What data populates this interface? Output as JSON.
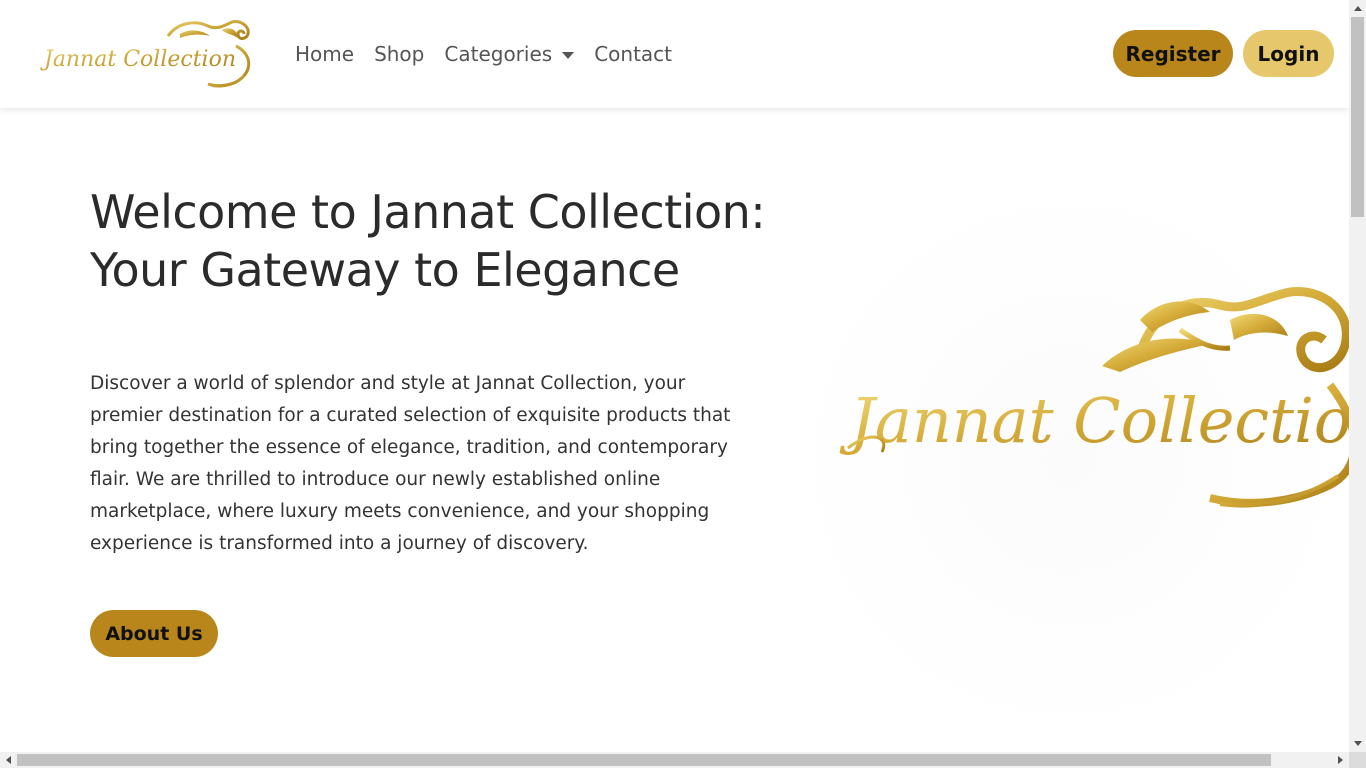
{
  "brand": {
    "logo_text": "Jannat Collection",
    "logo_color": "#c9a233"
  },
  "nav": {
    "links": [
      {
        "label": "Home"
      },
      {
        "label": "Shop"
      },
      {
        "label": "Categories"
      },
      {
        "label": "Contact"
      }
    ]
  },
  "auth": {
    "register_label": "Register",
    "login_label": "Login"
  },
  "hero": {
    "title": "Welcome to Jannat Collection: Your Gateway to Elegance",
    "text": "Discover a world of splendor and style at Jannat Collection, your premier destination for a curated selection of exquisite products that bring together the essence of elegance, tradition, and contemporary flair. We are thrilled to introduce our newly established online marketplace, where luxury meets convenience, and your shopping experience is transformed into a journey of discovery.",
    "about_label": "About Us",
    "image_text": "Jannat Collection"
  },
  "icons": {
    "dropdown": "caret-down-icon",
    "scroll_up": "arrow-up-icon",
    "scroll_down": "arrow-down-icon",
    "scroll_left": "arrow-left-icon",
    "scroll_right": "arrow-right-icon"
  },
  "colors": {
    "primary_gold": "#b8861b",
    "light_gold": "#e6c76b",
    "text_dark": "#2b2b2b",
    "nav_text": "#555555"
  }
}
